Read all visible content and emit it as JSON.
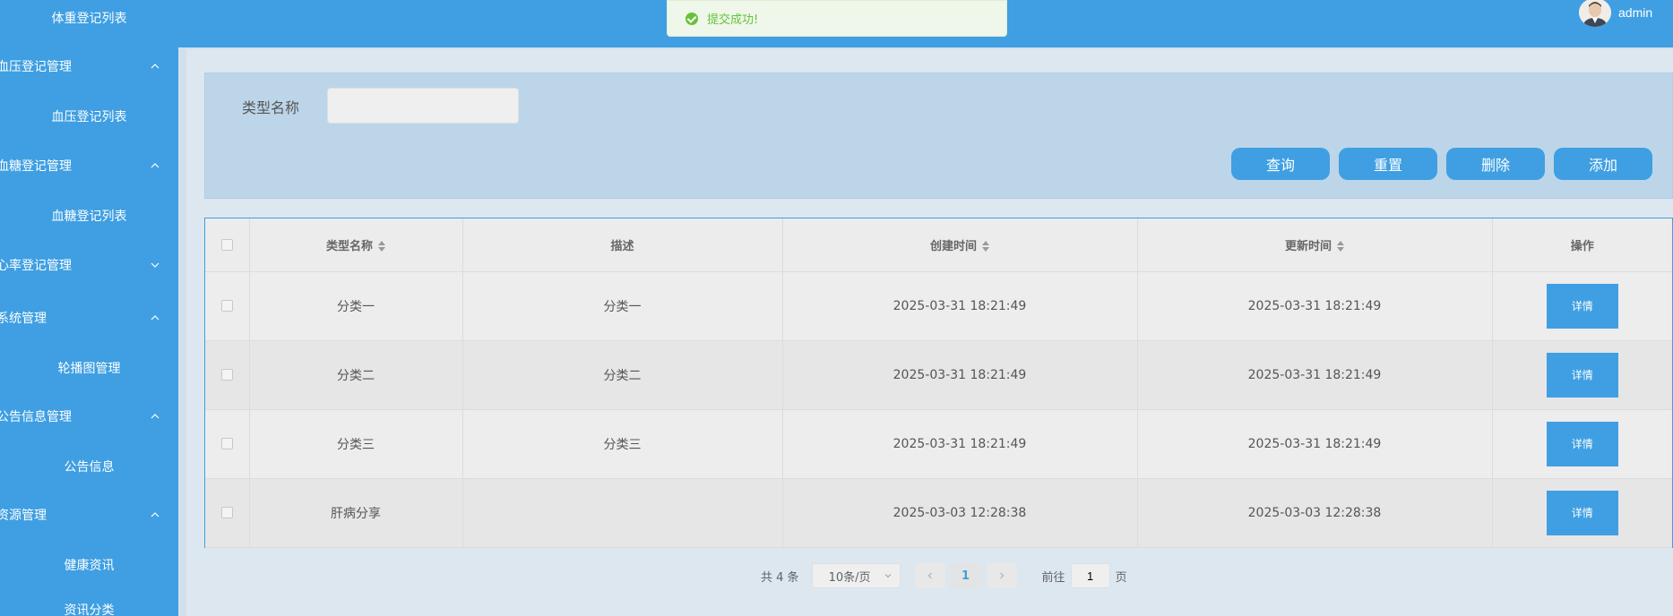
{
  "sidebar": {
    "items": [
      {
        "label": "体重登记列表",
        "type": "child"
      },
      {
        "label": "血压登记管理",
        "type": "parent",
        "expanded": true
      },
      {
        "label": "血压登记列表",
        "type": "child"
      },
      {
        "label": "血糖登记管理",
        "type": "parent",
        "expanded": true
      },
      {
        "label": "血糖登记列表",
        "type": "child"
      },
      {
        "label": "心率登记管理",
        "type": "parent",
        "expanded": false
      },
      {
        "label": "系统管理",
        "type": "parent",
        "expanded": true
      },
      {
        "label": "轮播图管理",
        "type": "child"
      },
      {
        "label": "公告信息管理",
        "type": "parent",
        "expanded": true
      },
      {
        "label": "公告信息",
        "type": "child"
      },
      {
        "label": "资源管理",
        "type": "parent",
        "expanded": true
      },
      {
        "label": "健康资讯",
        "type": "child"
      },
      {
        "label": "资讯分类",
        "type": "child"
      }
    ]
  },
  "header": {
    "username": "admin"
  },
  "toast": {
    "message": "提交成功!"
  },
  "search": {
    "label": "类型名称",
    "value": "",
    "placeholder": ""
  },
  "actions": {
    "query": "查询",
    "reset": "重置",
    "delete": "删除",
    "add": "添加"
  },
  "table": {
    "columns": [
      "类型名称",
      "描述",
      "创建时间",
      "更新时间",
      "操作"
    ],
    "rows": [
      {
        "name": "分类一",
        "desc": "分类一",
        "created": "2025-03-31 18:21:49",
        "updated": "2025-03-31 18:21:49",
        "action": "详情"
      },
      {
        "name": "分类二",
        "desc": "分类二",
        "created": "2025-03-31 18:21:49",
        "updated": "2025-03-31 18:21:49",
        "action": "详情"
      },
      {
        "name": "分类三",
        "desc": "分类三",
        "created": "2025-03-31 18:21:49",
        "updated": "2025-03-31 18:21:49",
        "action": "详情"
      },
      {
        "name": "肝病分享",
        "desc": "",
        "created": "2025-03-03 12:28:38",
        "updated": "2025-03-03 12:28:38",
        "action": "详情"
      }
    ]
  },
  "pagination": {
    "total": "共 4 条",
    "page_size": "10条/页",
    "current_page": "1",
    "goto_label": "前往",
    "goto_value": "1",
    "page_suffix": "页"
  },
  "colors": {
    "primary": "#3f9fe2",
    "success": "#67c23a"
  }
}
